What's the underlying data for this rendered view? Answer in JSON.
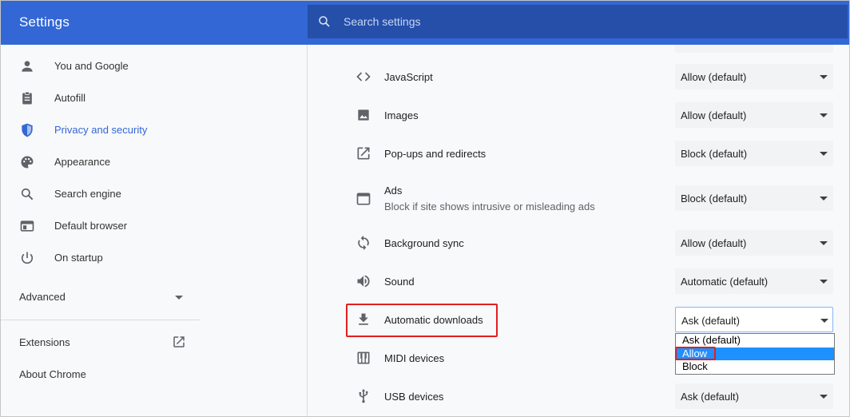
{
  "app": {
    "title": "Settings"
  },
  "search": {
    "placeholder": "Search settings"
  },
  "sidebar": {
    "items": [
      {
        "label": "You and Google",
        "icon": "person-icon"
      },
      {
        "label": "Autofill",
        "icon": "clipboard-icon"
      },
      {
        "label": "Privacy and security",
        "icon": "shield-icon",
        "active": true
      },
      {
        "label": "Appearance",
        "icon": "palette-icon"
      },
      {
        "label": "Search engine",
        "icon": "search-icon"
      },
      {
        "label": "Default browser",
        "icon": "browser-window-icon"
      },
      {
        "label": "On startup",
        "icon": "power-icon"
      }
    ],
    "advanced_label": "Advanced",
    "extensions_label": "Extensions",
    "about_label": "About Chrome"
  },
  "permissions": [
    {
      "title": "JavaScript",
      "icon": "code-icon",
      "value": "Allow (default)"
    },
    {
      "title": "Images",
      "icon": "image-icon",
      "value": "Allow (default)"
    },
    {
      "title": "Pop-ups and redirects",
      "icon": "open-in-new-icon",
      "value": "Block (default)"
    },
    {
      "title": "Ads",
      "subtitle": "Block if site shows intrusive or misleading ads",
      "icon": "ads-window-icon",
      "value": "Block (default)"
    },
    {
      "title": "Background sync",
      "icon": "sync-icon",
      "value": "Allow (default)"
    },
    {
      "title": "Sound",
      "icon": "speaker-icon",
      "value": "Automatic (default)"
    },
    {
      "title": "Automatic downloads",
      "icon": "download-icon",
      "value": "Ask (default)"
    },
    {
      "title": "MIDI devices",
      "icon": "piano-icon",
      "value": ""
    },
    {
      "title": "USB devices",
      "icon": "usb-icon",
      "value": "Ask (default)"
    }
  ],
  "dropdown": {
    "options": [
      "Ask (default)",
      "Allow",
      "Block"
    ],
    "highlighted": "Allow"
  },
  "colors": {
    "accent": "#3367d6",
    "highlight_box": "#e02020",
    "option_selected": "#1e90ff"
  }
}
